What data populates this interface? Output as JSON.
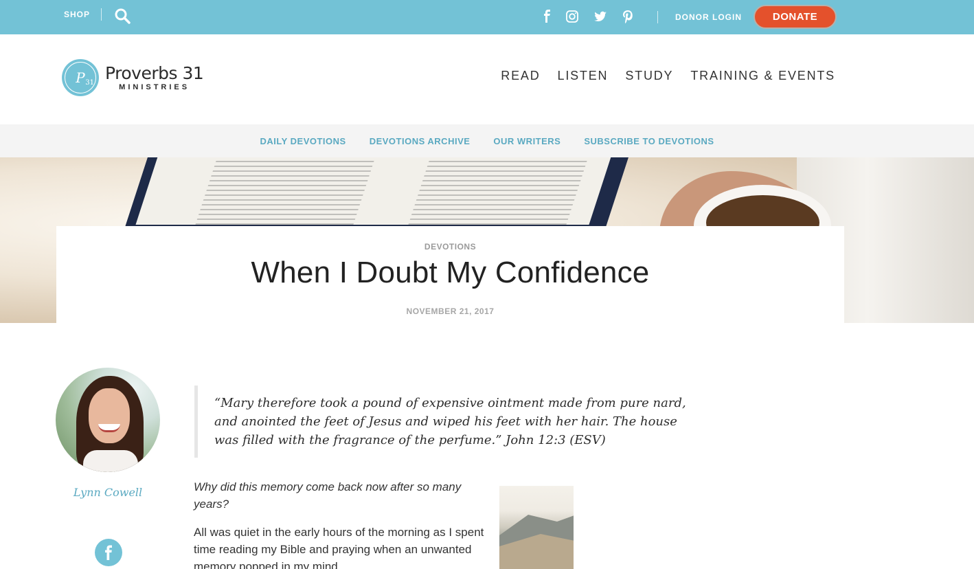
{
  "topbar": {
    "shop_label": "SHOP",
    "donor_login_label": "DONOR LOGIN",
    "donate_label": "DONATE",
    "social_icons": [
      "facebook-icon",
      "instagram-icon",
      "twitter-icon",
      "pinterest-icon"
    ]
  },
  "logo": {
    "title": "Proverbs 31",
    "subtitle": "MINISTRIES",
    "monogram": "P",
    "monogram_num": "31"
  },
  "main_nav": [
    "READ",
    "LISTEN",
    "STUDY",
    "TRAINING & EVENTS"
  ],
  "sub_nav": [
    "DAILY DEVOTIONS",
    "DEVOTIONS ARCHIVE",
    "OUR WRITERS",
    "SUBSCRIBE TO DEVOTIONS"
  ],
  "post": {
    "category": "DEVOTIONS",
    "title": "When I Doubt My Confidence",
    "date": "NOVEMBER 21, 2017"
  },
  "author": {
    "name": "Lynn Cowell"
  },
  "quote": {
    "text": "“Mary therefore took a pound of expensive ointment made from pure nard, and anointed the feet of Jesus and wiped his feet with her hair. The house was filled with the fragrance of the perfume.” John 12:3 (ESV)"
  },
  "body": {
    "question": "Why did this memory come back now after so many years?",
    "paragraph": "All was quiet in the early hours of the morning as I spent time reading my Bible and praying when an unwanted memory popped in my mind."
  },
  "colors": {
    "brand": "#73c2d6",
    "link": "#5aa9c1",
    "donate": "#e4512c"
  }
}
